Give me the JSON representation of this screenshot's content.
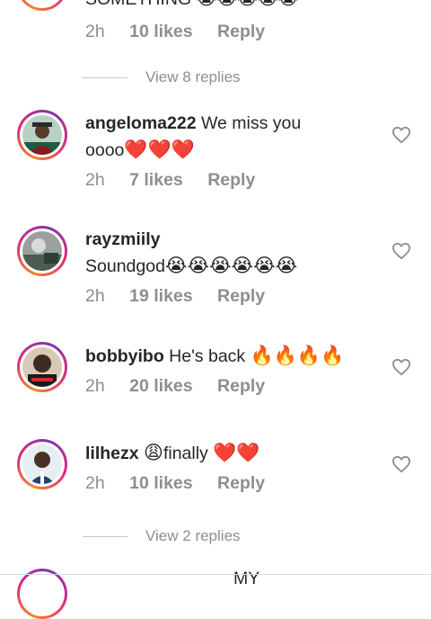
{
  "top_comment": {
    "time": "2h",
    "likes": "10 likes",
    "reply": "Reply",
    "partial_text": "SOMETHING 😭😭😭😭😭"
  },
  "view_replies_1": "View 8 replies",
  "comments": [
    {
      "username": "angeloma222",
      "text_line1": "We miss you",
      "text_line2": "oooo",
      "emoji": "❤️❤️❤️",
      "time": "2h",
      "likes": "7 likes",
      "reply": "Reply"
    },
    {
      "username": "rayzmiily",
      "text_line2": "Soundgod",
      "emoji": "😭😭😭😭😭😭",
      "time": "2h",
      "likes": "19 likes",
      "reply": "Reply"
    },
    {
      "username": "bobbyibo",
      "text_line1": "He's back",
      "emoji": "🔥🔥🔥🔥",
      "time": "2h",
      "likes": "20 likes",
      "reply": "Reply"
    },
    {
      "username": "lilhezx",
      "emoji_pre": "😩",
      "text_line1": "finally",
      "emoji": "❤️❤️",
      "time": "2h",
      "likes": "10 likes",
      "reply": "Reply"
    }
  ],
  "view_replies_2": "View 2 replies",
  "bottom_partial": "MY"
}
